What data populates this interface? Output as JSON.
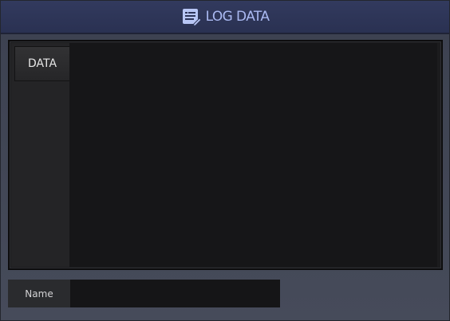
{
  "window": {
    "title": "LOG DATA",
    "title_icon": "log-document-icon",
    "accent_color": "#aab9f2"
  },
  "tabs": [
    {
      "label": "DATA",
      "active": true
    }
  ],
  "log_content": "",
  "name_field": {
    "label": "Name",
    "value": ""
  }
}
